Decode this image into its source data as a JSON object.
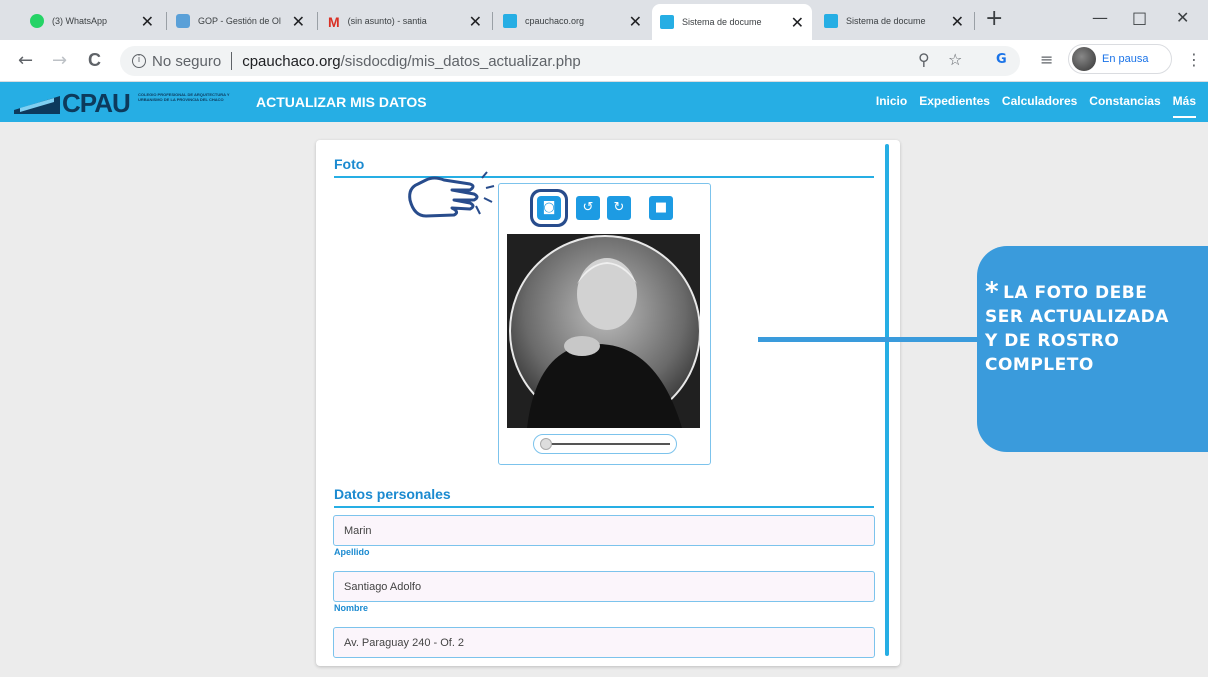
{
  "browser": {
    "tabs": [
      {
        "title": "(3) WhatsApp",
        "icon": "whatsapp-icon"
      },
      {
        "title": "GOP - Gestión de Ol",
        "icon": "gop-icon"
      },
      {
        "title": "(sin asunto) - santia",
        "icon": "gmail-icon"
      },
      {
        "title": "cpauchaco.org",
        "icon": "cpau-icon"
      },
      {
        "title": "Sistema de docume",
        "icon": "cpau-doc-icon"
      },
      {
        "title": "Sistema de docume",
        "icon": "cpau-doc-icon"
      }
    ],
    "new_tab": "+",
    "window_controls": {
      "minimize": "—",
      "restore": "□",
      "close": "✕"
    },
    "nav": {
      "back": "←",
      "forward": "→",
      "reload": "C"
    },
    "address": {
      "security_info": "i",
      "security": "No seguro",
      "host": "cpauchaco.org",
      "path": "/sisdocdig/mis_datos_actualizar.php"
    },
    "omni_icons": {
      "zoom": "⚲",
      "star": "☆",
      "ext": "G",
      "reading_list": "≡"
    },
    "profile": {
      "label": "En pausa"
    },
    "menu": "⋮"
  },
  "app": {
    "logo": "CPAU",
    "logo_sub": "COLEGIO PROFESIONAL DE ARQUITECTURA Y URBANISMO DE LA PROVINCIA DEL CHACO",
    "title": "ACTUALIZAR MIS DATOS",
    "nav": [
      "Inicio",
      "Expedientes",
      "Calculadores",
      "Constancias",
      "Más"
    ]
  },
  "form": {
    "photo_section": "Foto",
    "photo_buttons": [
      {
        "icon": "camera-icon",
        "glyph": "◙"
      },
      {
        "icon": "rotate-left-icon",
        "glyph": "↺"
      },
      {
        "icon": "rotate-right-icon",
        "glyph": "↻"
      },
      {
        "icon": "trash-icon",
        "glyph": "■"
      }
    ],
    "personal_section": "Datos personales",
    "fields": [
      {
        "value": "Marin",
        "label": "Apellido"
      },
      {
        "value": "Santiago Adolfo",
        "label": "Nombre"
      },
      {
        "value": "Av. Paraguay 240 - Of. 2",
        "label": ""
      }
    ]
  },
  "annotation": {
    "star": "*",
    "lines": [
      "LA FOTO DEBE",
      "SER ACTUALIZADA",
      "Y DE ROSTRO",
      "COMPLETO"
    ]
  },
  "colors": {
    "accent": "#26aee4",
    "label": "#1b8ad0",
    "annotation": "#3a9bdc",
    "logo": "#0d3a5c"
  }
}
